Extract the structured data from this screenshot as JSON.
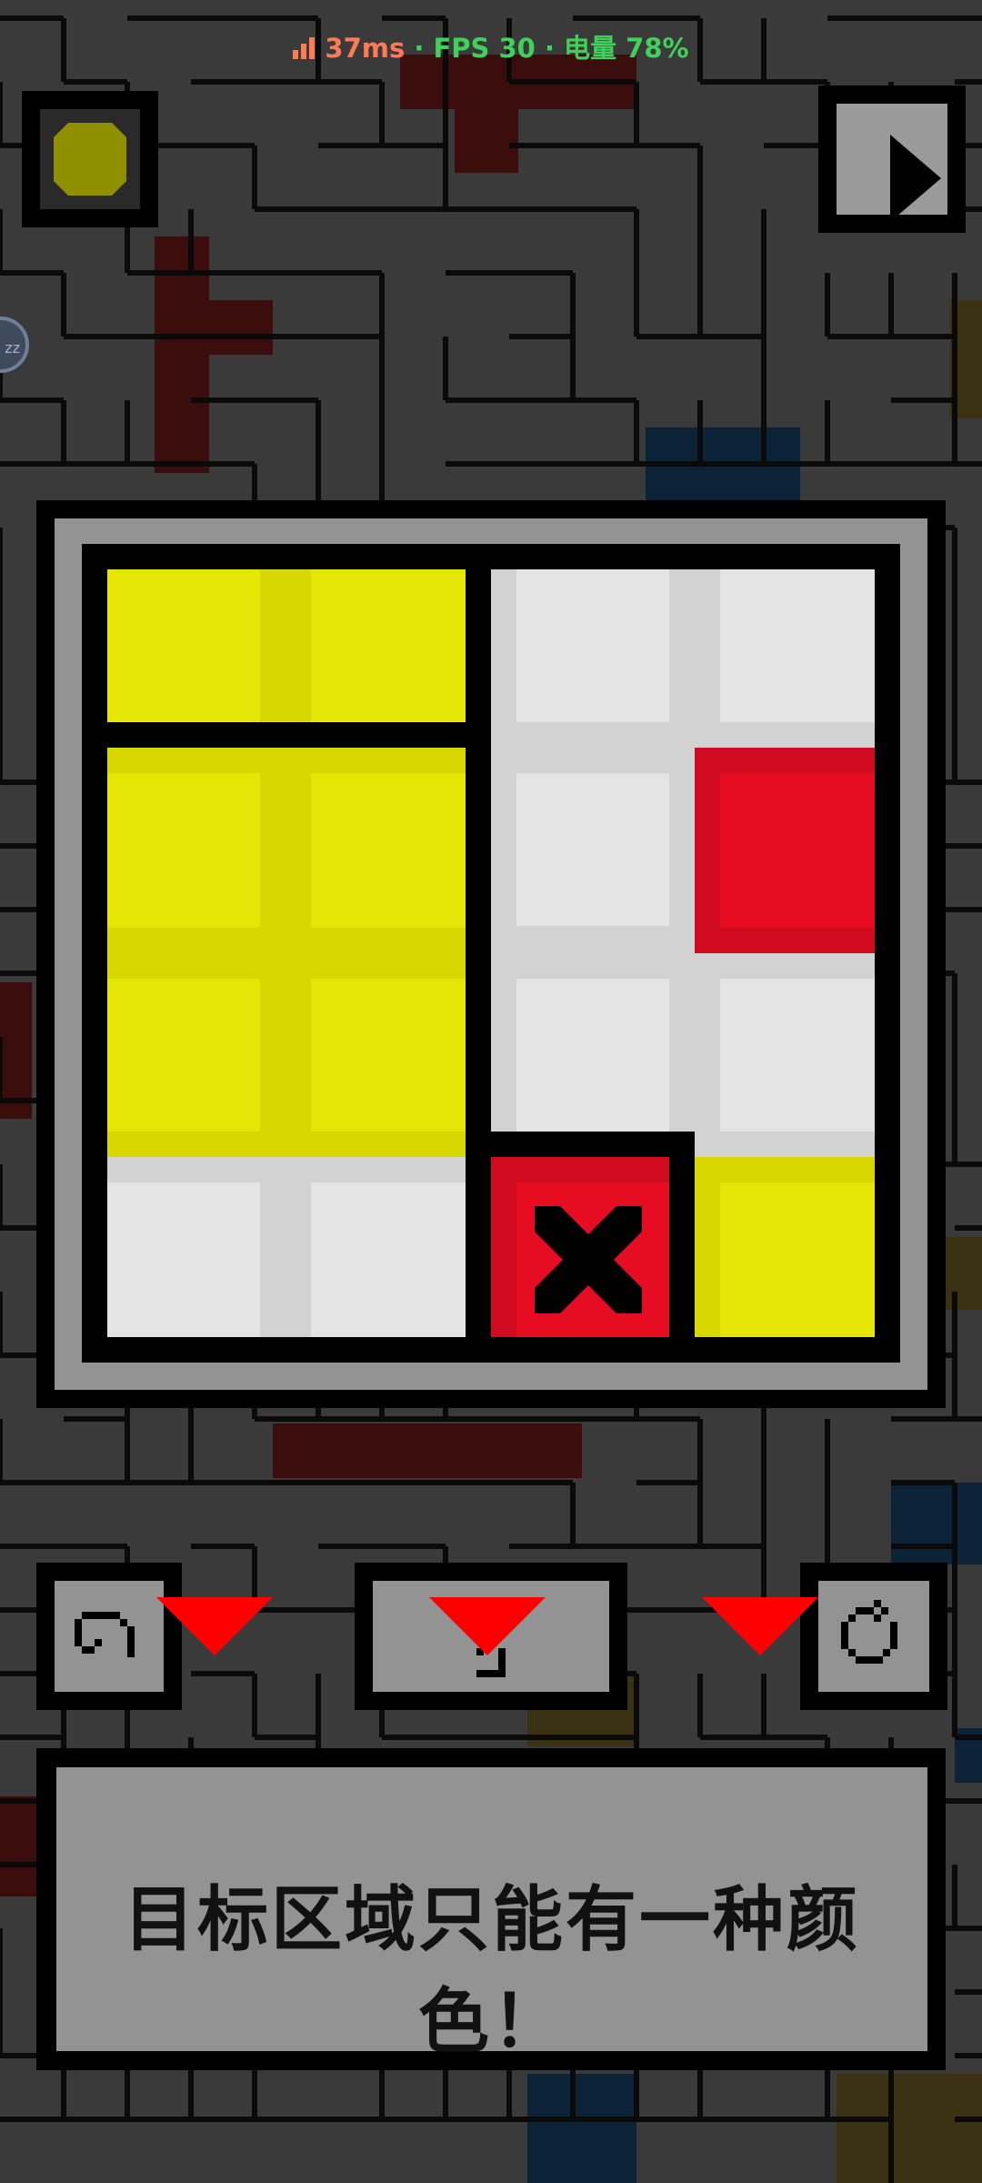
{
  "status_bar": {
    "ping": "37ms",
    "rest": " · FPS 30 · 电量 78%",
    "colors": {
      "ping": "#ff7b55",
      "ok": "#3fd15a"
    }
  },
  "top_left_button": {
    "icon": "coin-icon",
    "color": "#8f8f00"
  },
  "top_right_button": {
    "icon": "play-icon"
  },
  "side_bubble": {
    "label": "zz"
  },
  "board": {
    "rows": 4,
    "cols": 4,
    "colors": {
      "yellow": "#e6e606",
      "white": "#e4e4e4",
      "red": "#e60c22"
    },
    "regions": [
      {
        "name": "yellow-top",
        "color": "yellow"
      },
      {
        "name": "yellow-left-block",
        "color": "yellow"
      },
      {
        "name": "white-bottom-left",
        "color": "white"
      },
      {
        "name": "white-right-area",
        "color": "white"
      },
      {
        "name": "red-block",
        "color": "red"
      },
      {
        "name": "target-red-x",
        "color": "red"
      },
      {
        "name": "yellow-bottom-right",
        "color": "yellow"
      }
    ]
  },
  "controls": {
    "undo": {
      "icon": "undo-icon"
    },
    "hint": {
      "icon": "hint-icon"
    },
    "restart": {
      "icon": "restart-icon"
    },
    "arrow_color": "#ff0000"
  },
  "message": {
    "text": "目标区域只能有一种颜色！"
  }
}
